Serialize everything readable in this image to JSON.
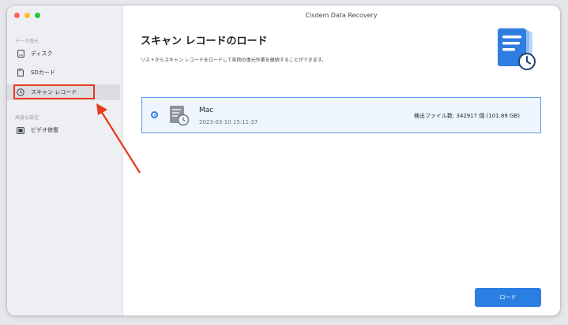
{
  "window": {
    "title": "Cisdem Data Recovery"
  },
  "sidebar": {
    "section1": "データ復元",
    "section2": "高度な設定",
    "items": [
      {
        "label": "ディスク",
        "icon": "disk-icon"
      },
      {
        "label": "SDカード",
        "icon": "sd-card-icon"
      },
      {
        "label": "スキャン レコード",
        "icon": "clock-icon",
        "selected": true
      },
      {
        "label": "ビデオ修復",
        "icon": "video-icon"
      }
    ]
  },
  "main": {
    "title": "スキャン レコードのロード",
    "subtitle": "リストからスキャン レコードをロードして前回の復元作業を継続することができます。",
    "record": {
      "name": "Mac",
      "date": "2023-03-10 15:11:37",
      "count": "検出ファイル数: 342917 個 (101.89 GB)",
      "selected": true
    },
    "load_button": "ロード"
  },
  "colors": {
    "accent": "#2b7fe3",
    "highlight": "#e8391c",
    "selection_bg": "#eef5fe"
  }
}
